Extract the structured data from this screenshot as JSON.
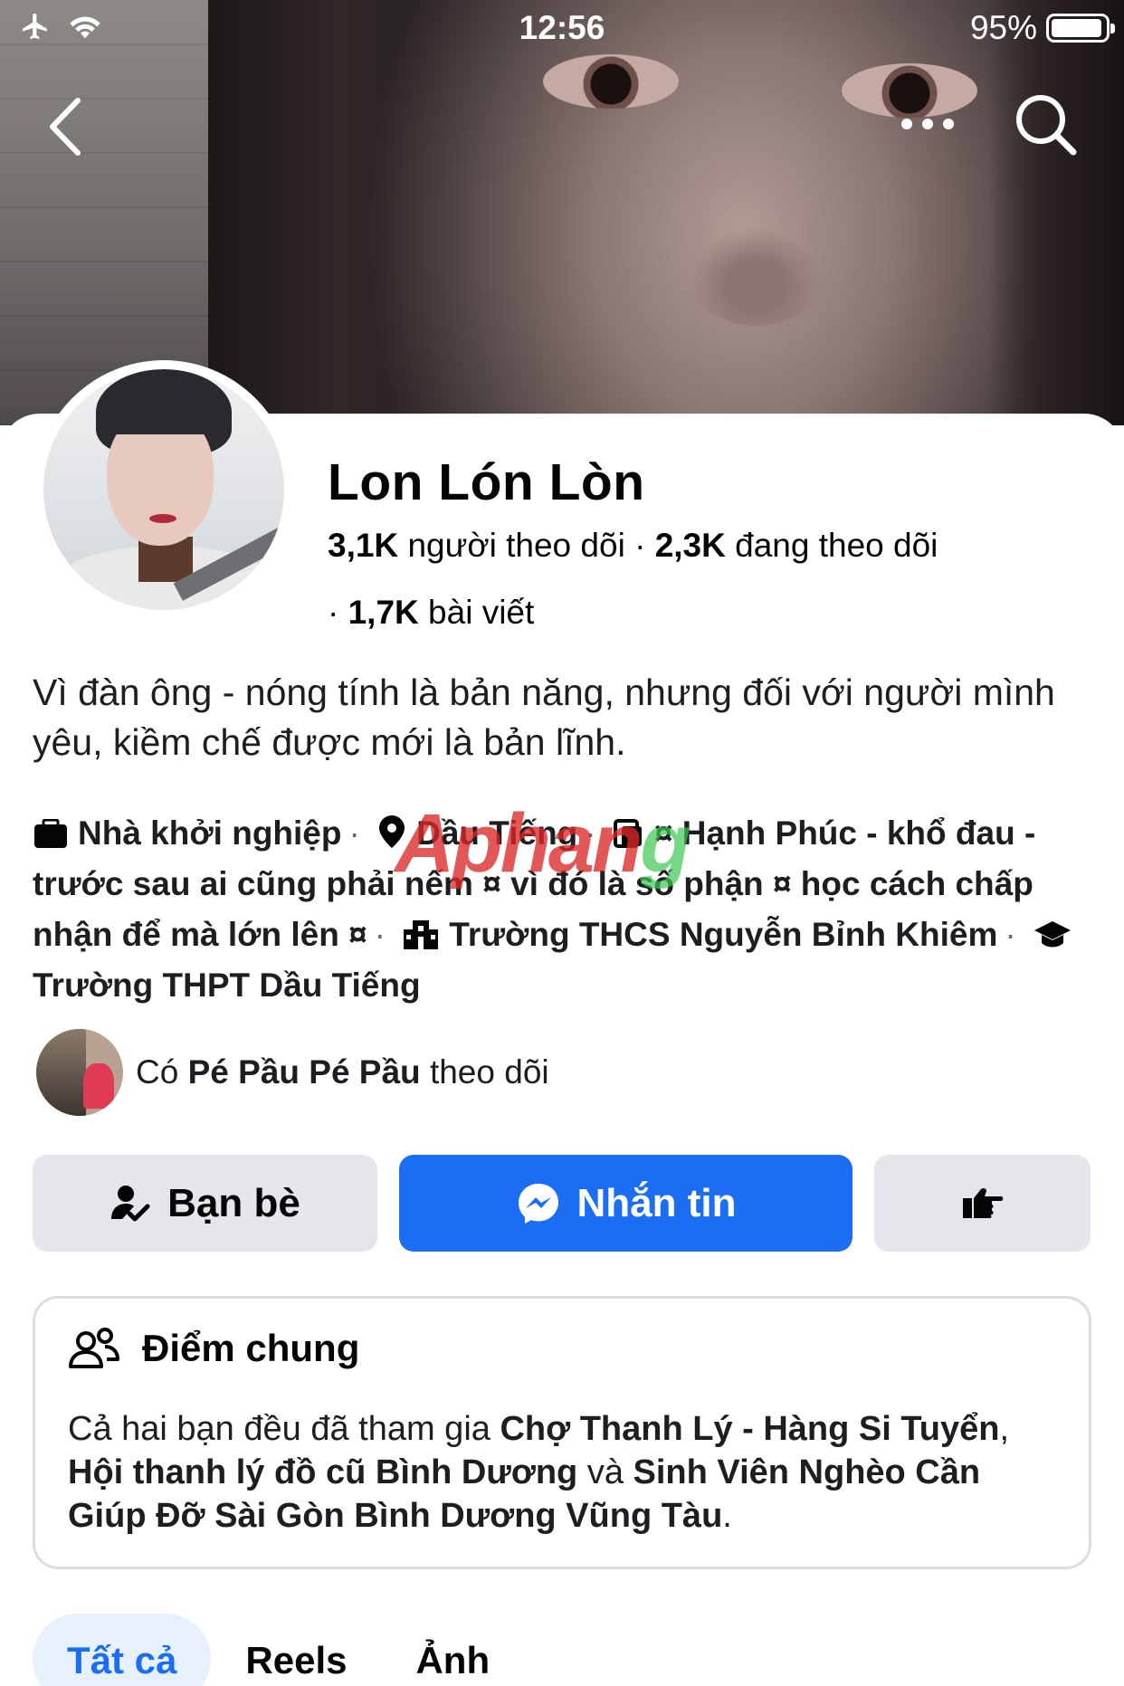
{
  "status_bar": {
    "time": "12:56",
    "battery": "95%",
    "battery_level": 0.95
  },
  "profile": {
    "name": "Lon Lón Lòn",
    "followers_count": "3,1K",
    "followers_label": "người theo dõi",
    "following_count": "2,3K",
    "following_label": "đang theo dõi",
    "posts_count": "1,7K",
    "posts_label": "bài viết",
    "bio": "Vì đàn ông - nóng tính là bản năng, nhưng đối với người mình yêu, kiềm chế được mới là bản lĩnh."
  },
  "details": {
    "work": "Nhà khởi nghiệp",
    "location": "Dầu Tiếng",
    "quote": "¤ Hạnh Phúc - khổ đau - trước sau ai cũng phải nếm ¤ vì đó là số phận ¤ học cách chấp nhận để mà lớn lên ¤",
    "school1": "Trường THCS Nguyễn Bỉnh Khiêm",
    "school2": "Trường THPT Dầu Tiếng"
  },
  "watermark": {
    "part1": "Aphan",
    "part2": "g"
  },
  "mutual": {
    "prefix": "Có",
    "name": "Pé Pầu Pé Pầu",
    "suffix": "theo dõi"
  },
  "actions": {
    "friends_label": "Bạn bè",
    "message_label": "Nhắn tin"
  },
  "common": {
    "title": "Điểm chung",
    "intro": "Cả hai bạn đều đã tham gia",
    "group1": "Chợ Thanh Lý - Hàng Si Tuyển",
    "comma": ",",
    "group2": "Hội thanh lý đồ cũ Bình Dương",
    "and": "và",
    "group3": "Sinh Viên Nghèo Cần Giúp Đỡ Sài Gòn Bình Dương Vũng Tàu",
    "end": "."
  },
  "tabs": [
    "Tất cả",
    "Reels",
    "Ảnh"
  ],
  "colors": {
    "accent": "#1b6ef3",
    "button_gray": "#e4e6eb",
    "tab_active_bg": "#e7f0fd"
  }
}
